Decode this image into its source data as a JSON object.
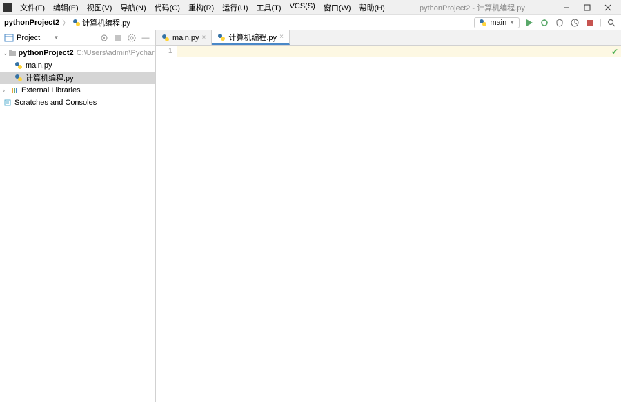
{
  "window": {
    "title": "pythonProject2 - 计算机编程.py"
  },
  "menu": [
    "文件(F)",
    "编辑(E)",
    "视图(V)",
    "导航(N)",
    "代码(C)",
    "重构(R)",
    "运行(U)",
    "工具(T)",
    "VCS(S)",
    "窗口(W)",
    "帮助(H)"
  ],
  "breadcrumb": {
    "project": "pythonProject2",
    "file": "计算机编程.py"
  },
  "run_config": {
    "label": "main"
  },
  "sidebar": {
    "title": "Project",
    "tree": {
      "root": {
        "name": "pythonProject2",
        "path": "C:\\Users\\admin\\PycharmProjects\\p"
      },
      "files": [
        {
          "name": "main.py"
        },
        {
          "name": "计算机编程.py"
        }
      ],
      "external": "External Libraries",
      "scratches": "Scratches and Consoles"
    }
  },
  "tabs": [
    {
      "label": "main.py",
      "active": false
    },
    {
      "label": "计算机编程.py",
      "active": true
    }
  ],
  "editor": {
    "line_number": "1"
  }
}
